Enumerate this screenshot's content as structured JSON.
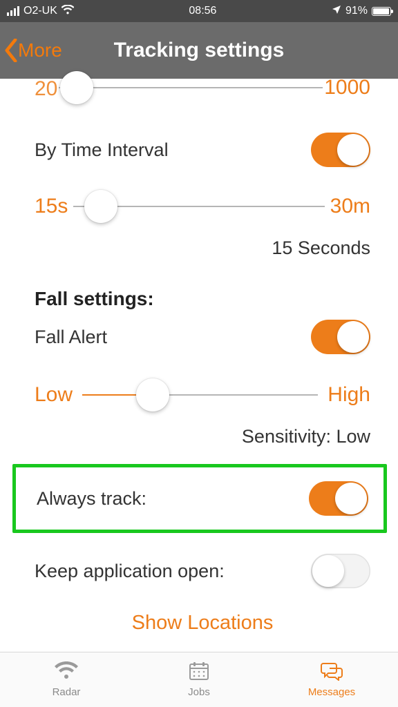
{
  "status": {
    "carrier": "O2-UK",
    "time": "08:56",
    "battery": "91%"
  },
  "nav": {
    "back_label": "More",
    "title": "Tracking settings"
  },
  "slider_distance": {
    "min_label": "20",
    "max_label": "1000"
  },
  "time_interval": {
    "label": "By Time Interval",
    "on": true,
    "slider": {
      "min_label": "15s",
      "max_label": "30m"
    },
    "current": "15 Seconds"
  },
  "fall": {
    "heading": "Fall settings:",
    "alert_label": "Fall Alert",
    "alert_on": true,
    "slider": {
      "min_label": "Low",
      "max_label": "High"
    },
    "sensitivity_label": "Sensitivity: Low"
  },
  "always_track": {
    "label": "Always track:",
    "on": true
  },
  "keep_open": {
    "label": "Keep application open:",
    "on": false
  },
  "show_locations": "Show Locations",
  "tabs": {
    "radar": "Radar",
    "jobs": "Jobs",
    "messages": "Messages"
  },
  "colors": {
    "accent": "#ed7d1a",
    "highlight_border": "#19c81e"
  }
}
